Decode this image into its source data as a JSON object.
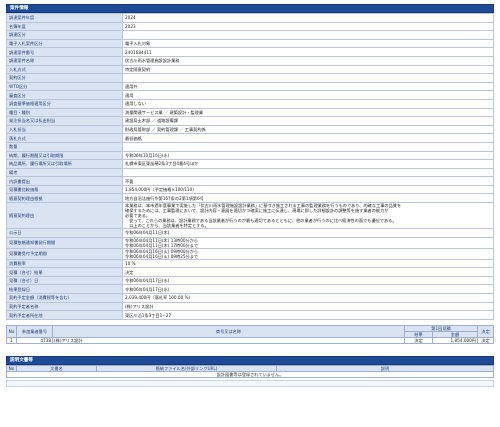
{
  "section1": {
    "title": "案件情報"
  },
  "rows": [
    {
      "k": "調達案件年度",
      "v": "2024"
    },
    {
      "k": "名簿年度",
      "v": "2023"
    },
    {
      "k": "調達区分",
      "v": ""
    },
    {
      "k": "電子入札案件区分",
      "v": "電子入札対象"
    },
    {
      "k": "調達案件番号",
      "v": "2401684411"
    },
    {
      "k": "調達案件名称",
      "v": "伏古川雨水管理施設設計業務"
    },
    {
      "k": "入札方式",
      "v": "特定随意契約"
    },
    {
      "k": "契約区分",
      "v": ""
    },
    {
      "k": "WTO区分",
      "v": "適用外"
    },
    {
      "k": "審査区分",
      "v": "適用"
    },
    {
      "k": "調査基準価格適用区分",
      "v": "適用しない"
    },
    {
      "k": "種目・種別",
      "v": "測量関連サービス業 ／ 建築設計・監理業"
    },
    {
      "k": "発注担当名又は払出担当",
      "v": "建設局土木部 ／ 道路設備課"
    },
    {
      "k": "入札担当",
      "v": "財政局管財部 ／ 契約管理課 ／ 工事契約係"
    },
    {
      "k": "落札方式",
      "v": "最低価格"
    },
    {
      "k": "数量",
      "v": ""
    },
    {
      "k": "納期、履行期間又は引取期限",
      "v": "令和06年10月16日(水)"
    },
    {
      "k": "納品場所、履行場所又は引取場所",
      "v": "札幌市東区東苗穂2条3丁目4番4号ほか"
    },
    {
      "k": "備考",
      "v": ""
    },
    {
      "k": "内訳書提出",
      "v": "不要"
    },
    {
      "k": "見積書比較価格",
      "v": "1,854,000円（予定価格×100/110）"
    },
    {
      "k": "随意契約理由根拠",
      "v": "地方自治法施行令第167条の2第1項第6号"
    }
  ],
  "reason": {
    "k": "随意契約理由",
    "lines": [
      "本業務は、本市過年度事業で実施した「伏古川雨水管理施設設計業務」に基づき施工される工事の監理業務を行うものであり、的確な工事の品質を",
      "確保するためには、工事監理において、設計内容・意図を適切かつ確実に施工に伝達し、現場に即した詳細設計の調整等を施す業者の能力が",
      "必要である。",
      "　従って、これらの業務は、設計業務である当該業者が行うのが最も適切であるとともに、他の業者が行うのに比べ経済性の面でも優位である。",
      "　以上のことから、当該業者を特定とする。"
    ]
  },
  "rows2": [
    {
      "k": "公示日",
      "v": "令和06年04月11日(木)"
    },
    {
      "k": "見積依頼通知書発行期間",
      "v": "令和06年04月11日(木) 13時00分から\n令和06年04月11日(木) 17時00分まで"
    },
    {
      "k": "見積書受付予定期間",
      "v": "令和06年04月16日(火) 09時00分から\n令和06年04月16日(火) 09時25分まで"
    },
    {
      "k": "消費税率",
      "v": "10 %"
    },
    {
      "k": "見積（合せ）結果",
      "v": "決定"
    },
    {
      "k": "見積（合せ）日",
      "v": "令和06年04月17日(水)"
    },
    {
      "k": "結果登録日",
      "v": "令和06年04月17日(水)"
    },
    {
      "k": "契約予定金額（消費税等を含む）",
      "v": "2,039,400円（落札率 100.00 %）"
    },
    {
      "k": "契約予定者名称",
      "v": "(株)アリス設計"
    },
    {
      "k": "契約予定者所在地",
      "v": "東区川沿1条3丁目1−27"
    }
  ],
  "bids": {
    "h_no": "No",
    "h_reg": "参加業者番号",
    "h_name": "商号又は名称",
    "h_round": "第1回見積",
    "h_result": "結果",
    "h_amount": "金額",
    "h_decision": "決定",
    "rows": [
      {
        "no": "1",
        "reg": "4738",
        "name": "(株)アリス設計",
        "result": "決定",
        "amount": "1,854,000円",
        "decision": "決定"
      }
    ]
  },
  "section2": {
    "title": "説明文書等"
  },
  "docs": {
    "h_no": "No",
    "h_doc": "文書名",
    "h_file": "格納ファイル名(外部リンクURL)",
    "h_desc": "説明",
    "empty": "設計図書等は登録されていません。"
  }
}
